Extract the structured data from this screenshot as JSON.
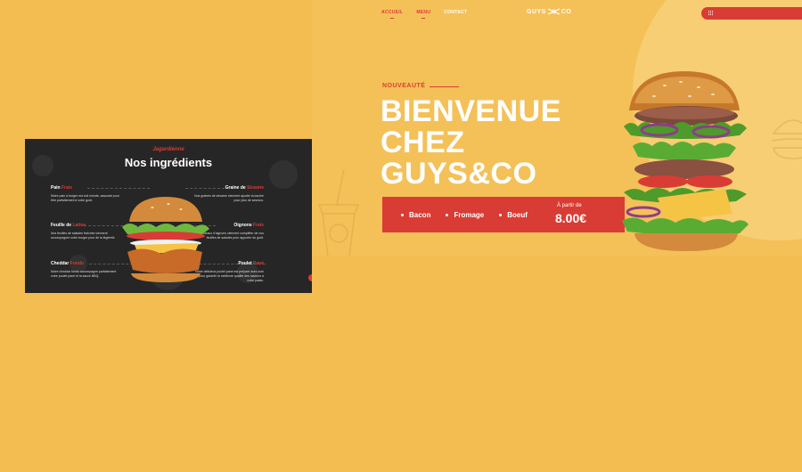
{
  "nav": {
    "items": [
      {
        "label": "ACCUEIL",
        "active": true
      },
      {
        "label": "MENU",
        "active": true
      },
      {
        "label": "CONTACT",
        "active": false
      }
    ]
  },
  "logo": {
    "left": "GUYS",
    "right": "CO"
  },
  "hero": {
    "kicker": "NOUVEAUTÉ",
    "title_lines": [
      "BIENVENUE",
      "CHEZ",
      "GUYS&CO"
    ]
  },
  "offer": {
    "items": [
      "Bacon",
      "Fromage",
      "Boeuf"
    ],
    "from_label": "À partir de",
    "price": "8.00€"
  },
  "ingredients_card": {
    "script": "Jagardienne",
    "title": "Nos ingrédients",
    "left": [
      {
        "name": "Pain",
        "accent": "Frais",
        "desc": "Notre pain à burger est cuit minute, assurant pour être parfaitement à votre goût."
      },
      {
        "name": "Feuille de",
        "accent": "Laitue",
        "desc": "Nos feuilles de salades fraîches viennent accompagner notre burger pour de la légèreté."
      },
      {
        "name": "Cheddar",
        "accent": "Fondu",
        "desc": "Notre cheddar fondu accompagne parfaitement votre poulet pané et la sauce BBQ."
      }
    ],
    "right": [
      {
        "name": "Graine de",
        "accent": "Sésame",
        "desc": "Nos graines de sésame viennent ajouter la touche pour plus de saveurs."
      },
      {
        "name": "Oignons",
        "accent": "Frais",
        "desc": "Nos anneaux d'oignons viennent compléter de nos feuilles de salades pour apporter du goût."
      },
      {
        "name": "Poulet",
        "accent": "Pané",
        "desc": "Notre délicieux poulet pané est préparé avec soin pour garantir la meilleure qualité des saveurs à votre palais."
      }
    ]
  },
  "colors": {
    "accent": "#d93c35",
    "background": "#f3bd52",
    "card": "#262626"
  },
  "icons": [
    "menu-grid-icon",
    "cup-doodle-icon",
    "burger-doodle-icon",
    "logo-mark-icon"
  ]
}
